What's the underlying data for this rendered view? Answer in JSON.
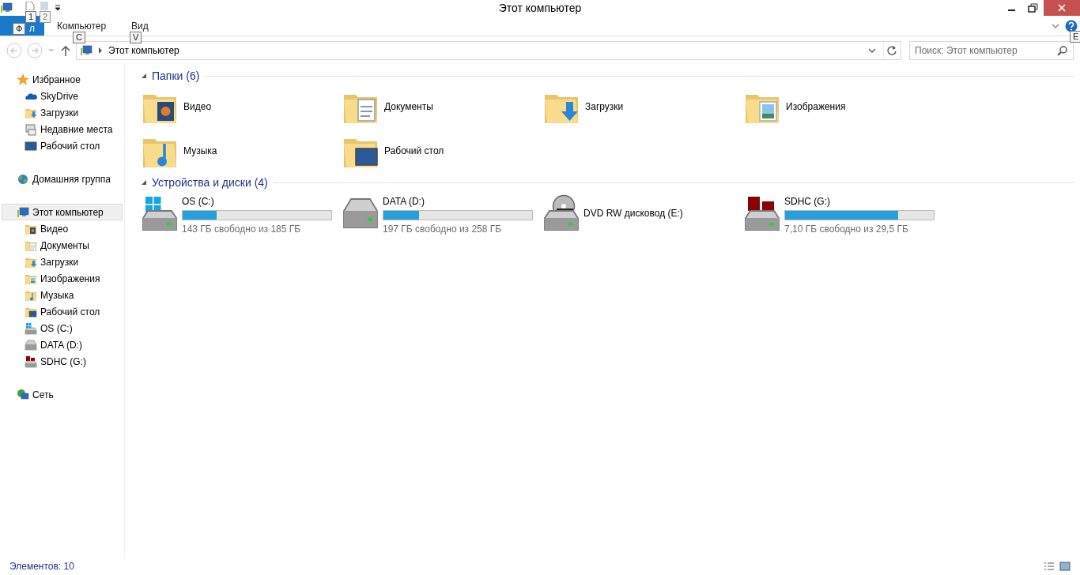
{
  "window": {
    "title": "Этот компьютер"
  },
  "quick_access": [
    {
      "kind": "file",
      "keytip": "1",
      "disabled": false
    },
    {
      "kind": "props",
      "keytip": "2",
      "disabled": true
    }
  ],
  "ribbon_tabs": [
    {
      "label": "л",
      "kind": "file",
      "keytip": "Ф",
      "selected": false
    },
    {
      "label": "Компьютер",
      "kind": "tab",
      "keytip": "C",
      "selected": false
    },
    {
      "label": "Вид",
      "kind": "tab",
      "keytip": "V",
      "selected": false
    }
  ],
  "help_keytip": "E",
  "address": {
    "path": "Этот компьютер"
  },
  "search": {
    "placeholder": "Поиск: Этот компьютер"
  },
  "sidebar": [
    {
      "label": "Избранное",
      "kind": "star",
      "selected": false,
      "children": [
        {
          "label": "SkyDrive",
          "kind": "cloud",
          "selected": false
        },
        {
          "label": "Загрузки",
          "kind": "downloads",
          "selected": false
        },
        {
          "label": "Недавние места",
          "kind": "recent",
          "selected": false
        },
        {
          "label": "Рабочий стол",
          "kind": "desktop",
          "selected": false
        }
      ]
    },
    {
      "label": "Домашняя группа",
      "kind": "homegroup",
      "selected": false
    },
    {
      "label": "Этот компьютер",
      "kind": "computer",
      "selected": true,
      "children": [
        {
          "label": "Видео",
          "kind": "video",
          "selected": false
        },
        {
          "label": "Документы",
          "kind": "documents",
          "selected": false
        },
        {
          "label": "Загрузки",
          "kind": "downloads",
          "selected": false
        },
        {
          "label": "Изображения",
          "kind": "pictures",
          "selected": false
        },
        {
          "label": "Музыка",
          "kind": "music",
          "selected": false
        },
        {
          "label": "Рабочий стол",
          "kind": "desktopfolder",
          "selected": false
        },
        {
          "label": "OS (C:)",
          "kind": "os",
          "selected": false
        },
        {
          "label": "DATA (D:)",
          "kind": "drive",
          "selected": false
        },
        {
          "label": "SDHC (G:)",
          "kind": "sd",
          "selected": false
        }
      ]
    },
    {
      "label": "Сеть",
      "kind": "network",
      "selected": false
    }
  ],
  "sections": [
    {
      "title": "Папки (6)",
      "expanded": true,
      "items": [
        {
          "name": "Видео",
          "kind": "video"
        },
        {
          "name": "Документы",
          "kind": "documents"
        },
        {
          "name": "Загрузки",
          "kind": "downloads"
        },
        {
          "name": "Изображения",
          "kind": "pictures"
        },
        {
          "name": "Музыка",
          "kind": "music"
        },
        {
          "name": "Рабочий стол",
          "kind": "desktopfolder"
        }
      ]
    },
    {
      "title": "Устройства и диски (4)",
      "expanded": true,
      "items": [
        {
          "name": "OS (C:)",
          "kind": "os",
          "level": 0.23,
          "reading": "143 ГБ свободно из 185 ГБ"
        },
        {
          "name": "DATA (D:)",
          "kind": "drive",
          "level": 0.24,
          "reading": "197 ГБ свободно из 258 ГБ"
        },
        {
          "name": "DVD RW дисковод (E:)",
          "kind": "dvd"
        },
        {
          "name": "SDHC (G:)",
          "kind": "sd",
          "level": 0.76,
          "reading": "7,10 ГБ свободно из 29,5 ГБ"
        }
      ]
    }
  ],
  "status_bar": {
    "count": "Элементов: 10"
  }
}
